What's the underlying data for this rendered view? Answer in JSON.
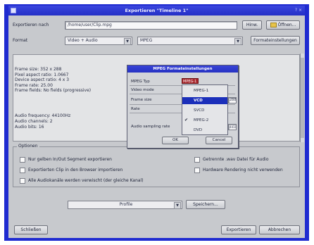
{
  "window": {
    "title": "Exportieren \"Timeline 1\"",
    "title_right": "? ×"
  },
  "export": {
    "label": "Exportieren nach",
    "path": "/home/user/Clip.mpg",
    "hint_label": "Hinw.",
    "browse_label": "Öffnen..."
  },
  "format": {
    "label": "Format",
    "type_value": "Video + Audio",
    "codec_value": "MPEG",
    "settings_label": "Formateinstellungen"
  },
  "info": {
    "lines": [
      "Frame size: 352 x 288",
      "Pixel aspect ratio: 1.0667",
      "Device aspect ratio: 4 x 3",
      "Frame rate: 25.00",
      "Frame fields: No fields (progressive)",
      "",
      "Audio frequency: 44100Hz",
      "Audio channels: 2",
      "Audio bits: 16"
    ]
  },
  "options": {
    "title": "Optionen",
    "items": [
      "Nur gelben In/Out Segment exportieren",
      "Exportierten Clip in den Browser importieren",
      "Alle Audiokanäle werden verwischt (der gleiche Kanal)",
      "Getrennte .wav Datei für Audio",
      "Hardware Rendering nicht verwenden"
    ]
  },
  "profile": {
    "value": "Profile",
    "save_label": "Speichern..."
  },
  "buttons": {
    "left": "Schließen",
    "export": "Exportieren",
    "cancel": "Abbrechen"
  },
  "mpeg_dialog": {
    "title": "MPEG Formateinstellungen",
    "rows": [
      {
        "label": "MPEG Typ",
        "value": "MPEG-1"
      },
      {
        "label": "Video mode",
        "value": ""
      },
      {
        "label": "Frame size",
        "value": "288"
      },
      {
        "label": "Rate",
        "value": ""
      },
      {
        "label": "Audio sampling rate",
        "value": "44100"
      }
    ],
    "ok_label": "OK",
    "cancel_label": "Cancel"
  },
  "mpeg_menu": {
    "items": [
      "MPEG-1",
      "VCD",
      "SVCD",
      "MPEG-2",
      "DVD"
    ],
    "selected_index": 1,
    "checked_index": 3
  }
}
